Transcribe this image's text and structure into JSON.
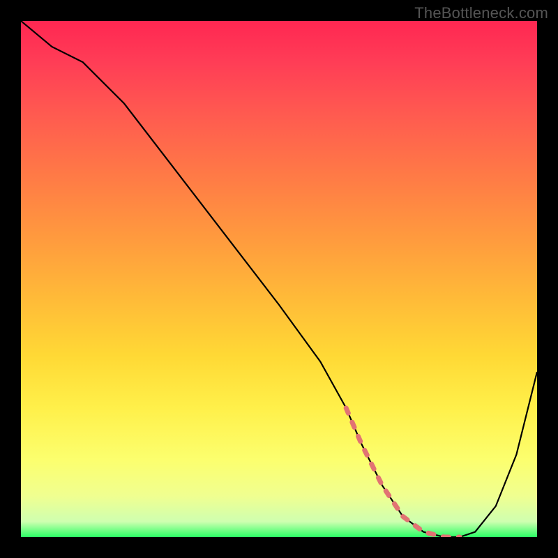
{
  "watermark": "TheBottleneck.com",
  "chart_data": {
    "type": "line",
    "title": "",
    "xlabel": "",
    "ylabel": "",
    "xlim": [
      0,
      100
    ],
    "ylim": [
      0,
      100
    ],
    "series": [
      {
        "name": "curve",
        "x": [
          0,
          6,
          12,
          20,
          30,
          40,
          50,
          58,
          63,
          66,
          70,
          74,
          78,
          82,
          85,
          88,
          92,
          96,
          100
        ],
        "y": [
          100,
          95,
          92,
          84,
          71,
          58,
          45,
          34,
          25,
          18,
          10,
          4,
          1,
          0,
          0,
          1,
          6,
          16,
          32
        ]
      }
    ],
    "optimal_band_x": [
      63,
      85
    ],
    "dashed_marker_color": "#e17373",
    "curve_color": "#000000"
  }
}
